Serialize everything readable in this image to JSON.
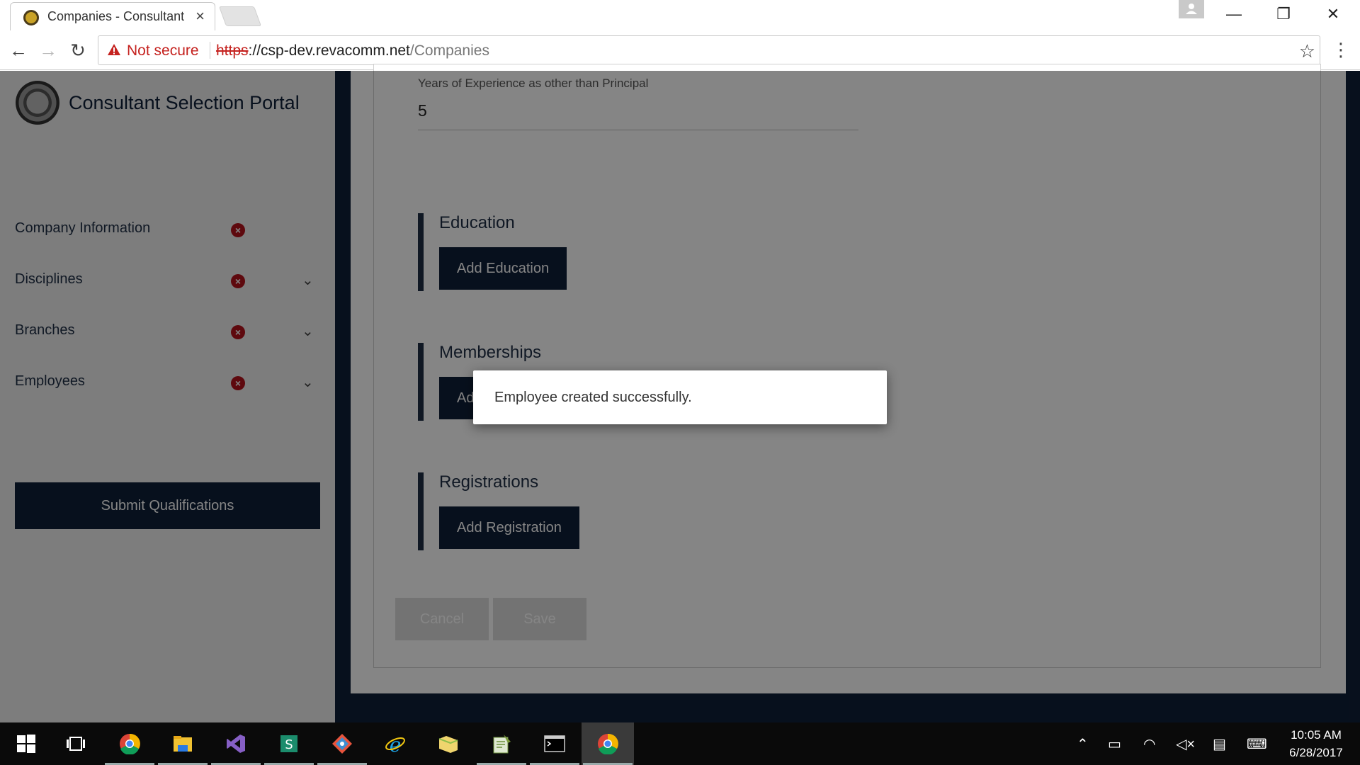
{
  "browser": {
    "tab_title": "Companies - Consultant",
    "tab_close": "×",
    "security_label": "Not secure",
    "url_scheme": "https",
    "url_host": "://csp-dev.revacomm.net",
    "url_path": "/Companies",
    "window_controls": [
      "—",
      "❐",
      "✕"
    ]
  },
  "sidebar": {
    "title": "Consultant Selection Portal",
    "items": [
      {
        "label": "Company Information",
        "has_error": true,
        "expandable": false
      },
      {
        "label": "Disciplines",
        "has_error": true,
        "expandable": true
      },
      {
        "label": "Branches",
        "has_error": true,
        "expandable": true
      },
      {
        "label": "Employees",
        "has_error": true,
        "expandable": true
      }
    ],
    "submit_label": "Submit Qualifications"
  },
  "form": {
    "years_label": "Years of Experience as other than Principal",
    "years_value": "5",
    "sections": [
      {
        "title": "Education",
        "button": "Add Education"
      },
      {
        "title": "Memberships",
        "button": "Add Memberships"
      },
      {
        "title": "Registrations",
        "button": "Add Registration"
      }
    ],
    "cancel_label": "Cancel",
    "save_label": "Save"
  },
  "dialog": {
    "message": "Employee created successfully."
  },
  "taskbar": {
    "apps": [
      "start-icon",
      "task-view-icon",
      "chrome-icon",
      "file-explorer-icon",
      "visual-studio-icon",
      "sway-icon",
      "git-icon",
      "internet-explorer-icon",
      "folder-icon",
      "notepad-icon",
      "terminal-icon",
      "chrome-active-icon"
    ],
    "time": "10:05 AM",
    "date": "6/28/2017"
  },
  "colors": {
    "navy": "#0f1f38",
    "error": "#b5121b",
    "not_secure": "#c5221f"
  }
}
